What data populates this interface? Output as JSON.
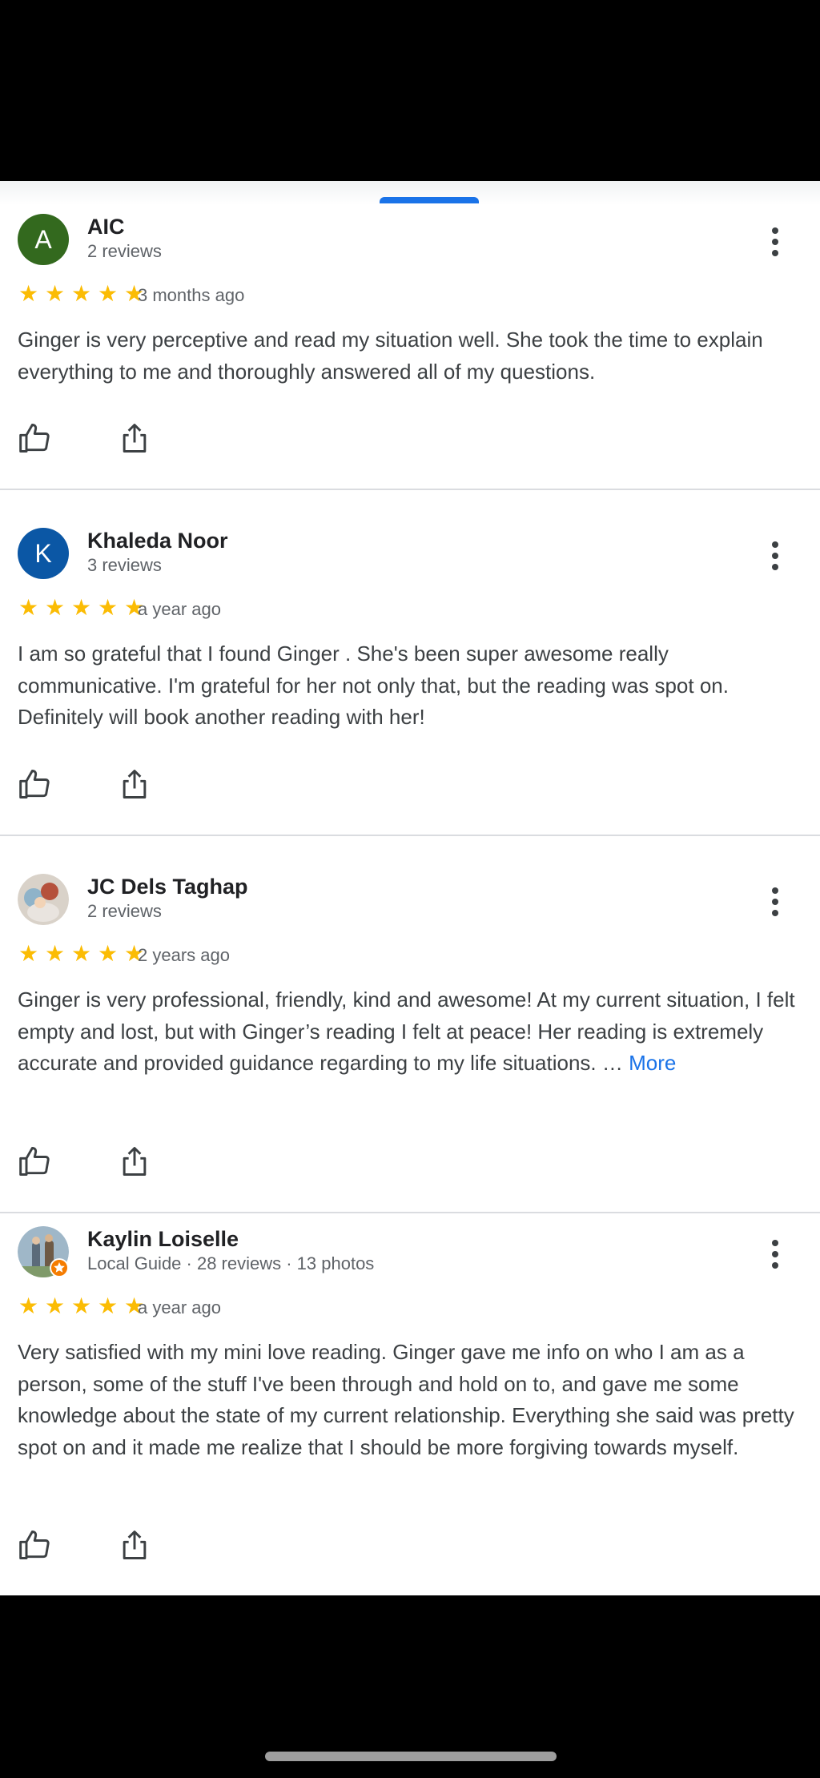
{
  "reviews": [
    {
      "name": "AIC",
      "avatar_letter": "A",
      "avatar_color": "#33691e",
      "meta": "2 reviews",
      "stars": 5,
      "date": "3 months ago",
      "text": "Ginger is very perceptive and read my situation well. She took the time to explain everything to me and thoroughly answered all of my questions."
    },
    {
      "name": "Khaleda Noor",
      "avatar_letter": "K",
      "avatar_color": "#0b57a5",
      "meta": "3 reviews",
      "stars": 5,
      "date": "a year ago",
      "text": "I am so grateful that I found Ginger . She's been super awesome really communicative. I'm grateful for her not only that, but the reading was spot on. Definitely will book another reading with her!"
    },
    {
      "name": "JC Dels Taghap",
      "avatar_icon": "photo-avatar",
      "meta": "2 reviews",
      "stars": 5,
      "date": "2 years ago",
      "text": "Ginger is very professional, friendly, kind and awesome! At my current situation, I felt empty and lost, but with Ginger’s reading I felt at peace! Her reading is extremely accurate and provided guidance regarding to my life situations. …",
      "more_label": "More"
    },
    {
      "name": "Kaylin Loiselle",
      "avatar_icon": "photo-avatar",
      "meta": "Local Guide · 28 reviews · 13 photos",
      "stars": 5,
      "date": "a year ago",
      "text": "Very satisfied with my mini love reading. Ginger gave me info on who I am as a person, some of the stuff I've been through and hold on to, and gave me some knowledge about the state of my current relationship. Everything she said was pretty spot on and it made me realize that I should be more forgiving towards myself."
    }
  ],
  "icons": {
    "like": "thumbs-up-icon",
    "share": "share-icon",
    "menu": "more-vert-icon",
    "star": "★"
  },
  "colors": {
    "star": "#fbbc04",
    "link": "#1a73e8",
    "handle": "#1a73e8"
  }
}
